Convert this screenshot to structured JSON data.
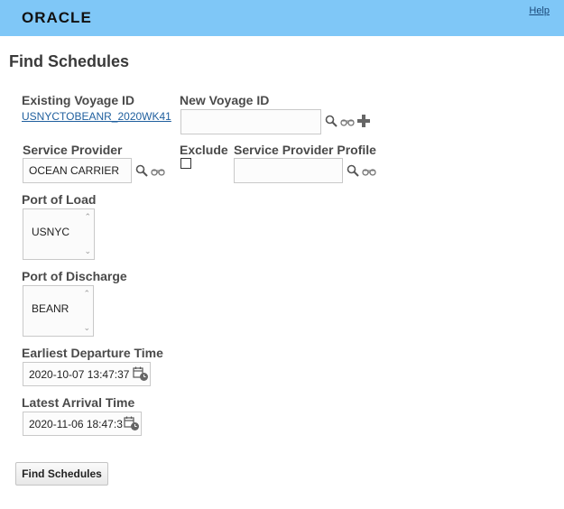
{
  "header": {
    "logo": "ORACLE",
    "help": "Help"
  },
  "page": {
    "title": "Find Schedules"
  },
  "existing_voyage": {
    "label": "Existing Voyage ID",
    "value": "USNYCTOBEANR_2020WK41"
  },
  "new_voyage": {
    "label": "New Voyage ID",
    "value": ""
  },
  "service_provider": {
    "label": "Service Provider",
    "value": "OCEAN CARRIER"
  },
  "exclude": {
    "label": "Exclude",
    "checked": false
  },
  "service_provider_profile": {
    "label": "Service Provider Profile",
    "value": ""
  },
  "port_of_load": {
    "label": "Port of Load",
    "value": "USNYC"
  },
  "port_of_discharge": {
    "label": "Port of Discharge",
    "value": "BEANR"
  },
  "earliest_departure": {
    "label": "Earliest Departure Time",
    "value": "2020-10-07 13:47:37"
  },
  "latest_arrival": {
    "label": "Latest Arrival Time",
    "value": "2020-11-06 18:47:3"
  },
  "actions": {
    "find_label": "Find Schedules"
  },
  "icons": {
    "search": "search-icon",
    "lookup": "glasses-icon",
    "add": "plus-icon",
    "calendar": "calendar-clock-icon"
  }
}
